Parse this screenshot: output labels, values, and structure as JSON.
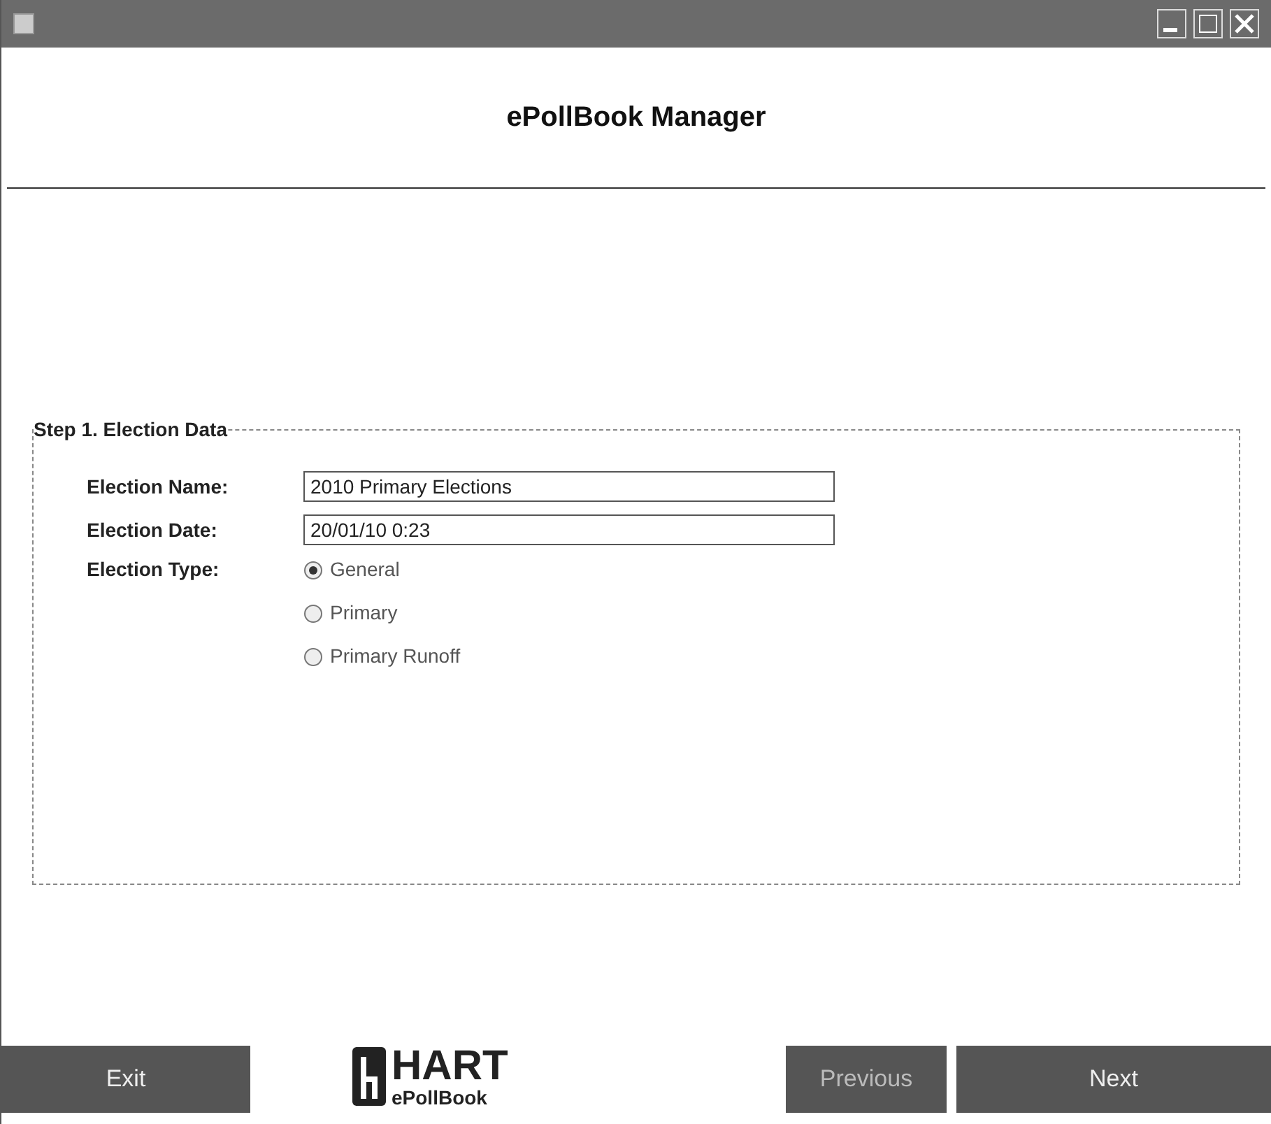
{
  "heading": "ePollBook Manager",
  "step": {
    "legend": "Step 1. Election Data",
    "fields": [
      {
        "label": "Election Name:",
        "value": "2010 Primary Elections"
      },
      {
        "label": "Election Date:",
        "value": "20/01/10 0:23"
      }
    ],
    "election_type": {
      "label": "Election Type:",
      "options": [
        {
          "label": "General",
          "selected": true
        },
        {
          "label": "Primary",
          "selected": false
        },
        {
          "label": "Primary Runoff",
          "selected": false
        }
      ]
    }
  },
  "buttons": [
    {
      "label": "Exit",
      "disabled": false
    },
    {
      "label": "Previous",
      "disabled": true
    },
    {
      "label": "Next",
      "disabled": false
    }
  ],
  "logo": {
    "brand": "HART",
    "product": "ePollBook"
  }
}
